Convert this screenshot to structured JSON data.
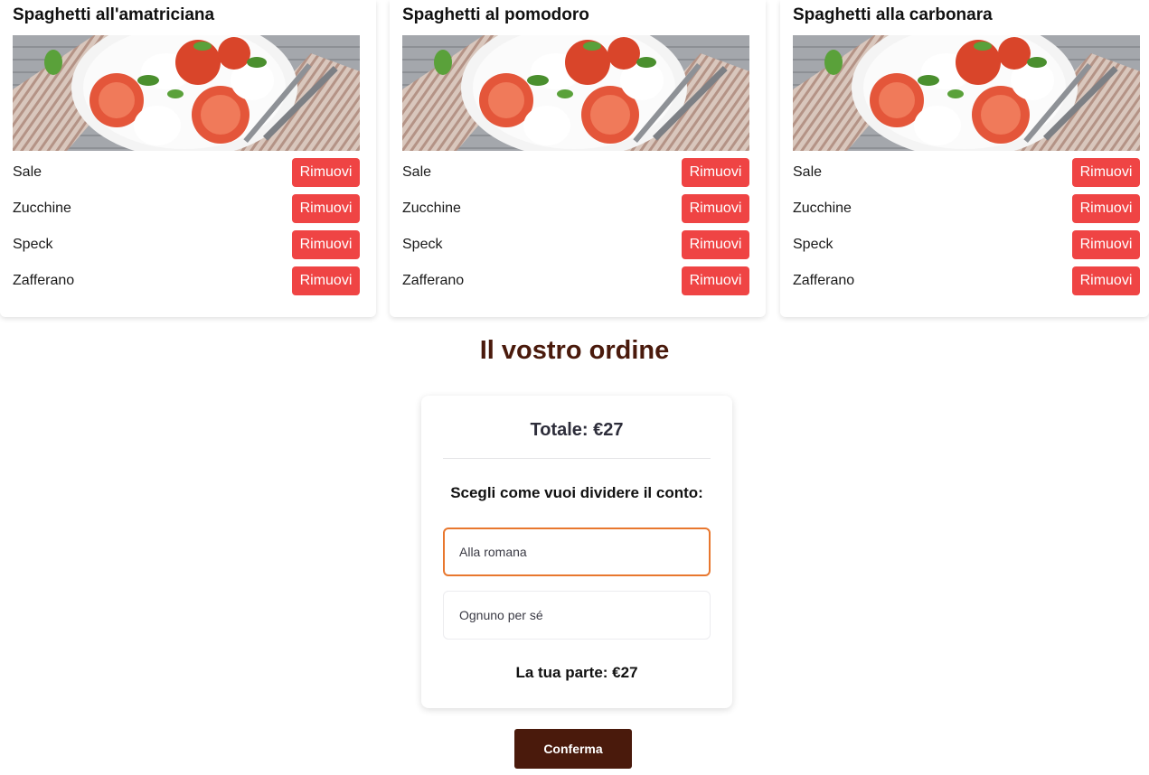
{
  "dishes": [
    {
      "title": "Spaghetti all'amatriciana",
      "ingredients": [
        {
          "name": "Sale",
          "remove_label": "Rimuovi"
        },
        {
          "name": "Zucchine",
          "remove_label": "Rimuovi"
        },
        {
          "name": "Speck",
          "remove_label": "Rimuovi"
        },
        {
          "name": "Zafferano",
          "remove_label": "Rimuovi"
        }
      ]
    },
    {
      "title": "Spaghetti al pomodoro",
      "ingredients": [
        {
          "name": "Sale",
          "remove_label": "Rimuovi"
        },
        {
          "name": "Zucchine",
          "remove_label": "Rimuovi"
        },
        {
          "name": "Speck",
          "remove_label": "Rimuovi"
        },
        {
          "name": "Zafferano",
          "remove_label": "Rimuovi"
        }
      ]
    },
    {
      "title": "Spaghetti alla carbonara",
      "ingredients": [
        {
          "name": "Sale",
          "remove_label": "Rimuovi"
        },
        {
          "name": "Zucchine",
          "remove_label": "Rimuovi"
        },
        {
          "name": "Speck",
          "remove_label": "Rimuovi"
        },
        {
          "name": "Zafferano",
          "remove_label": "Rimuovi"
        }
      ]
    }
  ],
  "order": {
    "title": "Il vostro ordine",
    "total": "Totale: €27",
    "split_question": "Scegli come vuoi dividere il conto:",
    "options": [
      {
        "label": "Alla romana",
        "selected": true
      },
      {
        "label": "Ognuno per sé",
        "selected": false
      }
    ],
    "share": "La tua parte: €27",
    "confirm_label": "Conferma"
  },
  "colors": {
    "remove_button": "#ef4444",
    "brand_brown": "#4a1a0c",
    "selected_outline": "#e8772e"
  }
}
